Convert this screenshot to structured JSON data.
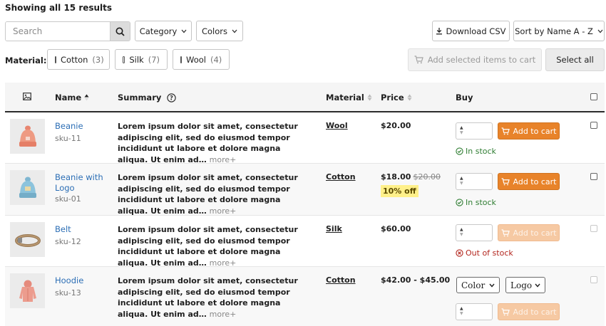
{
  "results_text": "Showing all 15 results",
  "search": {
    "placeholder": "Search"
  },
  "filters": {
    "category": "Category",
    "colors": "Colors"
  },
  "download_csv": "Download CSV",
  "sort_by": "Sort by Name A - Z",
  "material_filter": {
    "label": "Material:",
    "options": [
      {
        "name": "Cotton",
        "count": "(3)"
      },
      {
        "name": "Silk",
        "count": "(7)"
      },
      {
        "name": "Wool",
        "count": "(4)"
      }
    ]
  },
  "add_selected_label": "Add selected items to cart",
  "select_all_label": "Select all",
  "columns": {
    "name": "Name",
    "summary": "Summary",
    "material": "Material",
    "price": "Price",
    "buy": "Buy"
  },
  "summary_text": "Lorem ipsum dolor sit amet, consectetur adipiscing elit, sed do eiusmod tempor incididunt ut labore et dolore magna aliqua. Ut enim ad…",
  "more_label": "more+",
  "add_to_cart_label": "Add to cart",
  "products": [
    {
      "name": "Beanie",
      "sku": "sku-11",
      "material": "Wool",
      "price": "$20.00",
      "stock": "In stock",
      "in_stock": true
    },
    {
      "name": "Beanie with Logo",
      "sku": "sku-01",
      "material": "Cotton",
      "price": "$18.00",
      "old_price": "$20.00",
      "discount": "10% off",
      "stock": "In stock",
      "in_stock": true
    },
    {
      "name": "Belt",
      "sku": "sku-12",
      "material": "Silk",
      "price": "$60.00",
      "stock": "Out of stock",
      "in_stock": false
    },
    {
      "name": "Hoodie",
      "sku": "sku-13",
      "material": "Cotton",
      "price": "$42.00 - $45.00",
      "variant_color": "Color",
      "variant_logo": "Logo"
    }
  ],
  "colors": {
    "link": "#2c6eb5",
    "cart_button": "#e8832a",
    "in_stock": "#2f7d32",
    "out_of_stock": "#b3261e",
    "discount_bg": "#fff08a"
  }
}
